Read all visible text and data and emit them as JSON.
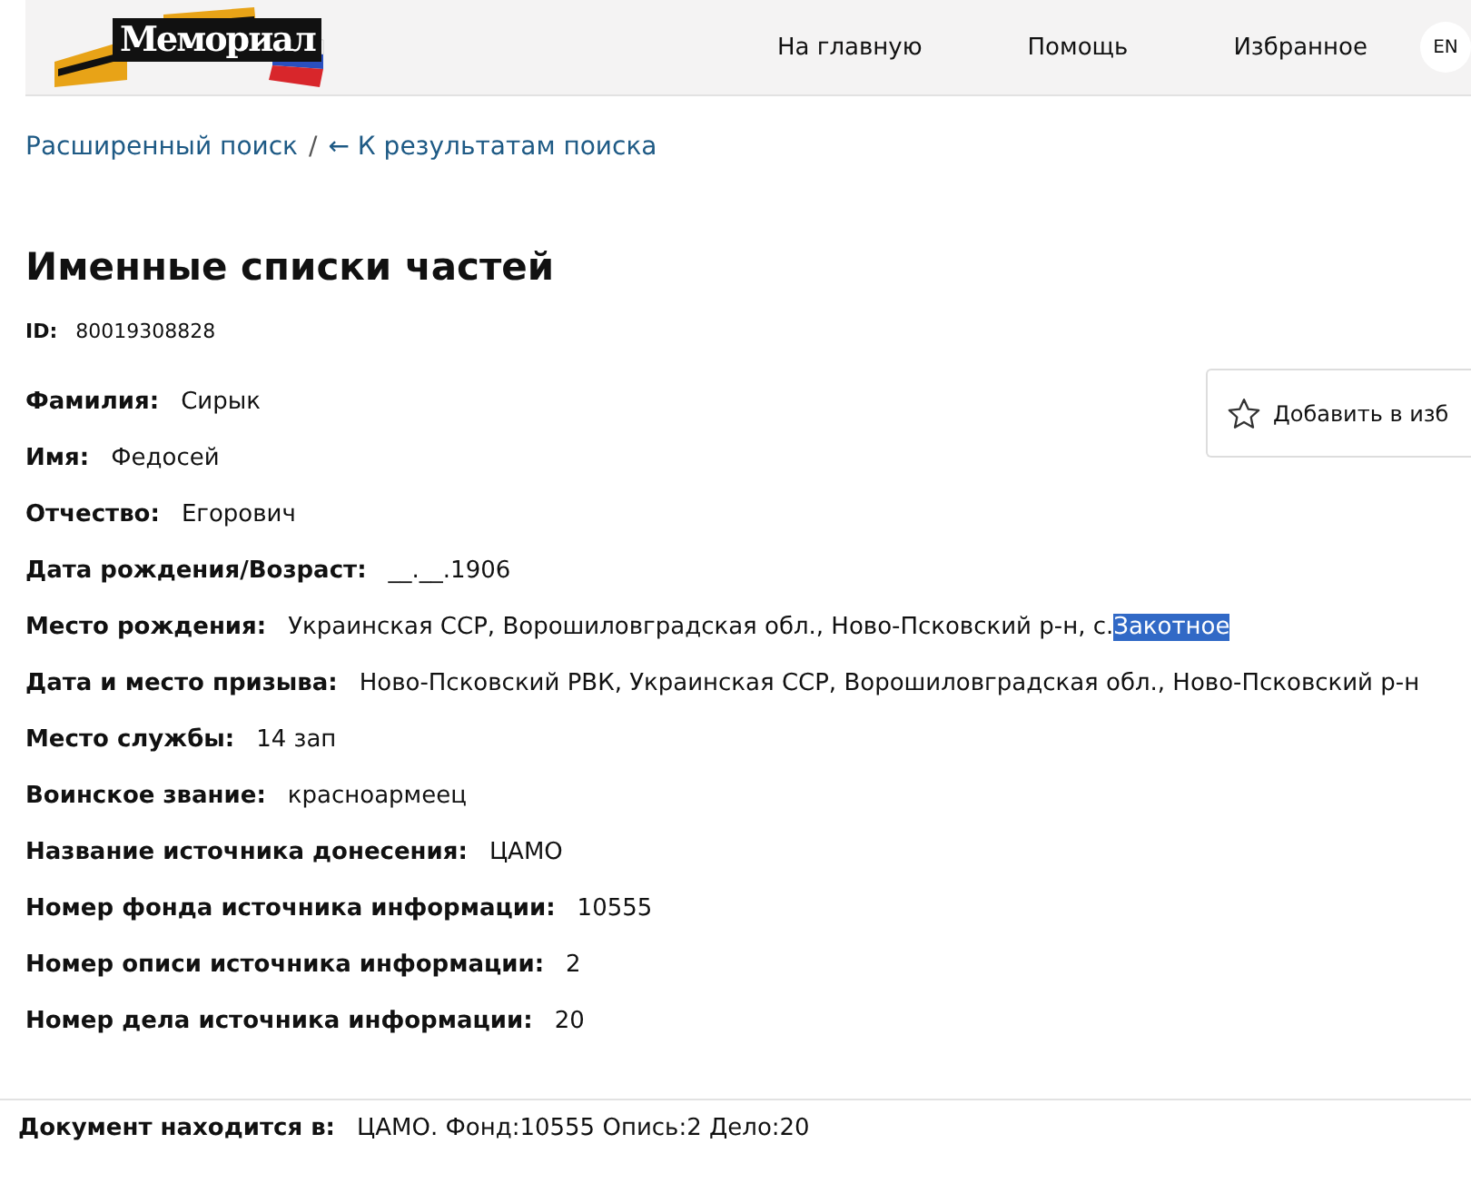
{
  "header": {
    "logo": "Мемориал",
    "nav": [
      "На главную",
      "Помощь",
      "Избранное"
    ],
    "language": "EN"
  },
  "breadcrumbs": [
    {
      "label": "Расширенный поиск",
      "kind": "link"
    },
    {
      "label": "/",
      "kind": "separator"
    },
    {
      "label": "← К результатам поиска",
      "kind": "link"
    }
  ],
  "title": "Именные списки частей",
  "id": {
    "label": "ID:",
    "value": "80019308828"
  },
  "favorite_button": {
    "label": "Добавить в изб"
  },
  "fields": [
    {
      "label": "Фамилия:",
      "value": "Сирык"
    },
    {
      "label": "Имя:",
      "value": "Федосей"
    },
    {
      "label": "Отчество:",
      "value": "Егорович"
    },
    {
      "label": "Дата рождения/Возраст:",
      "value": "__.__.1906"
    },
    {
      "label": "Место рождения:",
      "value": "Украинская ССР, Ворошиловградская обл., Ново-Псковский р-н, с.",
      "highlighted": "Закотное"
    },
    {
      "label": "Дата и место призыва:",
      "value": "Ново-Псковский РВК, Украинская ССР, Ворошиловградская обл., Ново-Псковский р-н"
    },
    {
      "label": "Место службы:",
      "value": "14 зап"
    },
    {
      "label": "Воинское звание:",
      "value": "красноармеец"
    },
    {
      "label": "Название источника донесения:",
      "value": "ЦАМО"
    },
    {
      "label": "Номер фонда источника информации:",
      "value": "10555"
    },
    {
      "label": "Номер описи источника информации:",
      "value": "2"
    },
    {
      "label": "Номер дела источника информации:",
      "value": "20"
    }
  ],
  "footer": {
    "label": "Документ находится в:",
    "value": "ЦАМО. Фонд:10555 Опись:2 Дело:20"
  }
}
